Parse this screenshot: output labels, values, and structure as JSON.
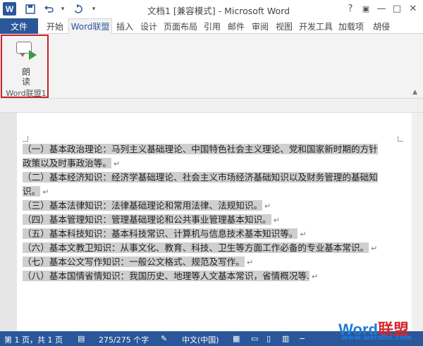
{
  "titlebar": {
    "app_logo": "W",
    "save_icon": "save-icon",
    "undo_icon": "undo-icon",
    "redo_icon": "redo-icon",
    "title": "文档1 [兼容模式] - Microsoft Word",
    "help": "?",
    "ribbon_opts": "▣",
    "minimize": "—",
    "maximize": "□",
    "close": "✕"
  },
  "tabs": {
    "file": "文件",
    "items": [
      "开始",
      "Word联盟",
      "插入",
      "设计",
      "页面布局",
      "引用",
      "邮件",
      "审阅",
      "视图",
      "开发工具",
      "加载项"
    ],
    "user": "胡侵"
  },
  "ribbon": {
    "read_button": "朗\n读",
    "group_label": "Word联盟1"
  },
  "document": {
    "lines": [
      "（一）基本政治理论：马列主义基础理论、中国特色社会主义理论、党和国家新时期的方针",
      "政策以及时事政治等。",
      "（二）基本经济知识：经济学基础理论、社会主义市场经济基础知识以及财务管理的基础知",
      "识。",
      "（三）基本法律知识：法律基础理论和常用法律、法规知识。",
      "（四）基本管理知识：管理基础理论和公共事业管理基本知识。",
      "（五）基本科技知识：基本科技常识、计算机与信息技术基本知识等。",
      "（六）基本文教卫知识：从事文化、教育、科技、卫生等方面工作必备的专业基本常识。",
      "（七）基本公文写作知识：一般公文格式、规范及写作。",
      "（八）基本国情省情知识：我国历史、地理等人文基本常识，省情概况等."
    ],
    "para_mark": "↵"
  },
  "statusbar": {
    "page": "第 1 页，共 1 页",
    "words": "275/275 个字",
    "lang": "中文(中国)"
  },
  "watermark": {
    "part_a": "Word",
    "part_b": "联盟",
    "url": "www.wordlm.com"
  },
  "colors": {
    "accent": "#2b579a",
    "highlight_box": "#c8202b",
    "selection": "#cfcfcf"
  }
}
